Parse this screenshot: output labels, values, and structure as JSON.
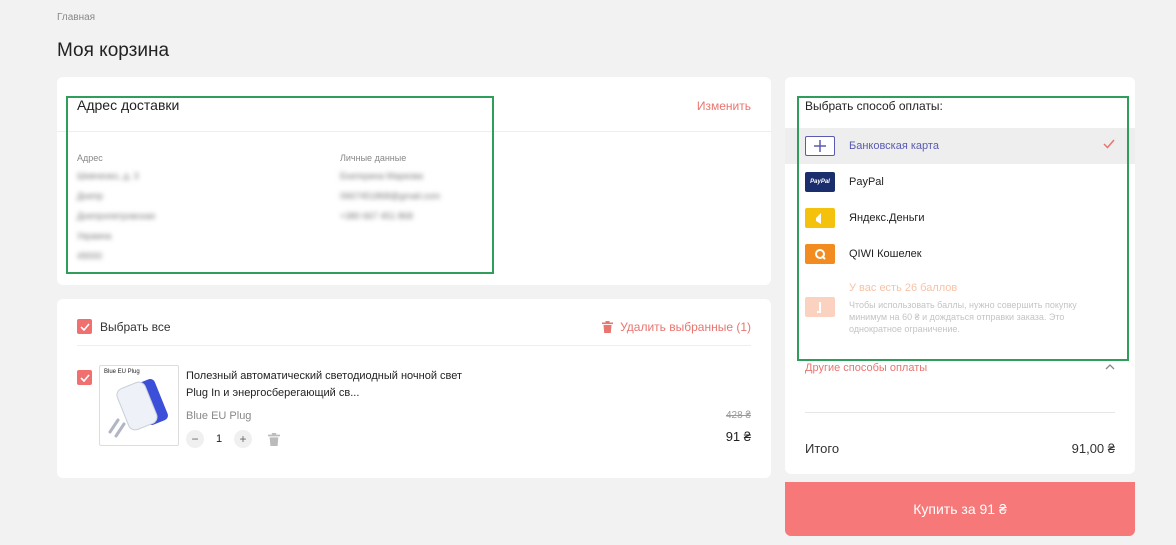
{
  "breadcrumb": "Главная",
  "page_title": "Моя корзина",
  "address": {
    "title": "Адрес доставки",
    "change_label": "Изменить",
    "address_label": "Адрес",
    "address_lines": [
      "Шевченко, д. 3",
      "Днепр",
      "Днепропетровская",
      "Украина",
      "49000"
    ],
    "personal_label": "Личные данные",
    "personal_lines": [
      "Екатерина Маркова",
      "0667451868@gmail.com",
      "+380 667 451 868"
    ]
  },
  "cart": {
    "select_all_label": "Выбрать все",
    "delete_selected_label": "Удалить выбранные (1)",
    "item": {
      "title": "Полезный автоматический светодиодный ночной свет Plug In и энергосберегающий св...",
      "thumb_caption": "Blue EU Plug",
      "variant": "Blue EU Plug",
      "quantity": "1",
      "old_price": "428 ₴",
      "price": "91 ₴"
    }
  },
  "payment": {
    "title": "Выбрать способ оплаты:",
    "methods": [
      {
        "label": "Банковская карта",
        "icon": "bank-card-icon",
        "selected": true
      },
      {
        "label": "PayPal",
        "icon": "paypal-icon",
        "icon_text": "PayPal",
        "selected": false
      },
      {
        "label": "Яндекс.Деньги",
        "icon": "yandex-money-icon",
        "selected": false
      },
      {
        "label": "QIWI Кошелек",
        "icon": "qiwi-icon",
        "selected": false
      }
    ],
    "bonus_title": "У вас есть 26 баллов",
    "bonus_desc": "Чтобы использовать баллы, нужно совершить покупку минимум на 60 ₴ и дождаться отправки заказа. Это однократное ограничение.",
    "other_methods_label": "Другие способы оплаты",
    "total_label": "Итого",
    "total_value": "91,00 ₴",
    "buy_label": "Купить за 91 ₴"
  },
  "colors": {
    "accent": "#f77878",
    "link": "#e8756f",
    "highlight": "#2e9e5a",
    "paypal": "#1a2e6e",
    "yandex": "#f4c20d",
    "qiwi": "#f28b20"
  }
}
